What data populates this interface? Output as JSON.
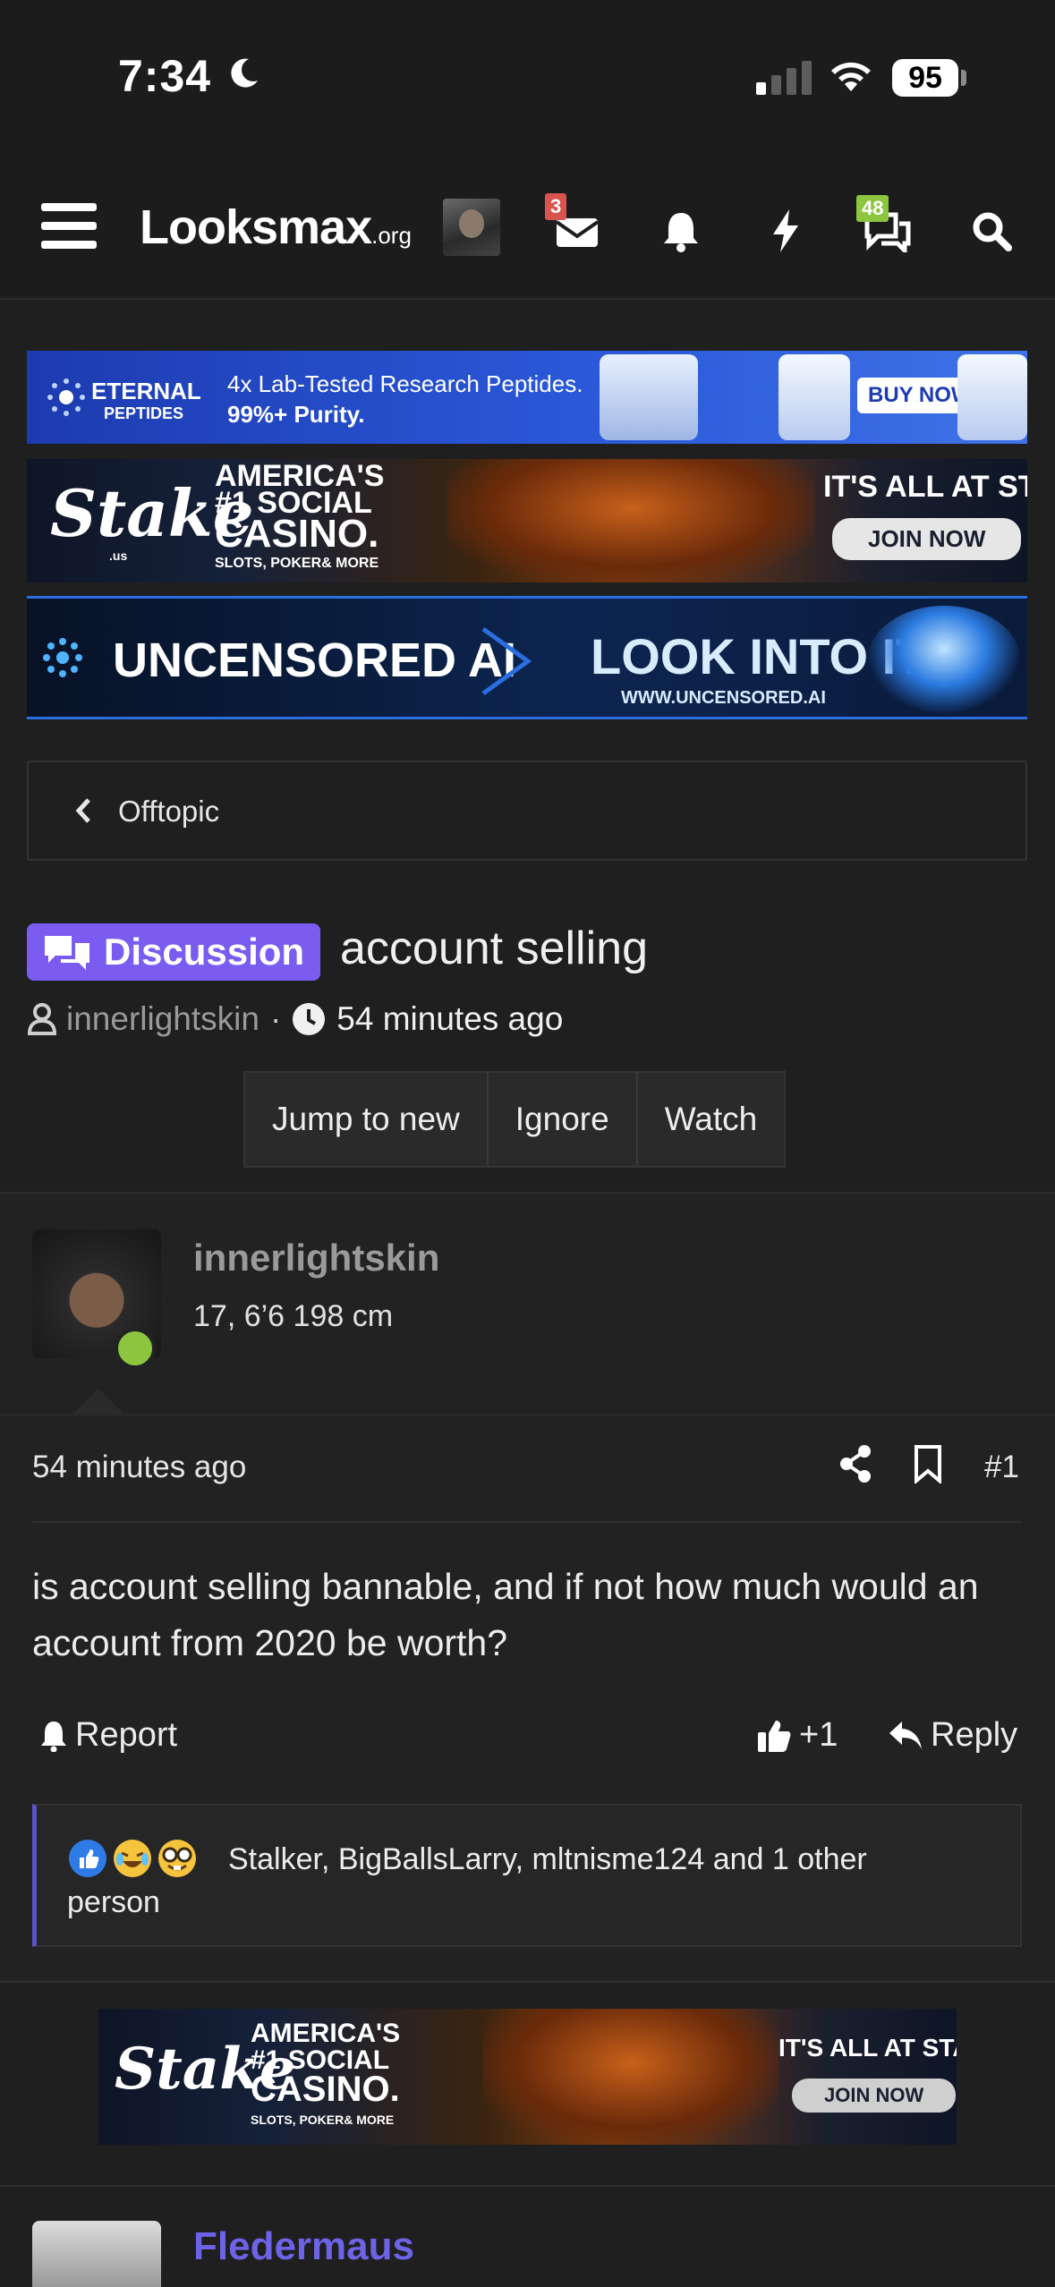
{
  "status_bar": {
    "time": "7:34",
    "battery": "95"
  },
  "nav": {
    "logo_main": "Looksmax",
    "logo_suffix": ".org",
    "inbox_badge": "3",
    "alerts_badge": "48"
  },
  "ads": {
    "eternal": {
      "brand": "ETERNAL",
      "brand_sub": "PEPTIDES",
      "line1": "4x Lab-Tested Research Peptides.",
      "line2": "99%+ Purity.",
      "cta": "BUY NOW"
    },
    "stake": {
      "brand": "Stake",
      "brand_sub": ".us",
      "head1": "AMERICA'S",
      "head2": "#1 SOCIAL",
      "head3": "CASINO.",
      "sub": "SLOTS, POKER& MORE",
      "tag": "IT'S ALL AT STAKE",
      "cta": "JOIN NOW"
    },
    "uncensored": {
      "brand": "UNCENSORED AI",
      "cta": "LOOK INTO IT",
      "url": "WWW.UNCENSORED.AI"
    }
  },
  "breadcrumb": {
    "label": "Offtopic"
  },
  "thread": {
    "prefix": "Discussion",
    "title": "account selling",
    "author": "innerlightskin",
    "separator": "·",
    "time": "54 minutes ago",
    "buttons": [
      "Jump to new",
      "Ignore",
      "Watch"
    ]
  },
  "post": {
    "username": "innerlightskin",
    "user_title": "17, 6’6 198 cm",
    "time": "54 minutes ago",
    "number": "#1",
    "body": "is account selling bannable, and if not how much would an account from 2020 be worth?",
    "report": "Report",
    "like_count": "+1",
    "reply": "Reply",
    "reactions_text": "Stalker, BigBallsLarry, mltnisme124 and 1 other person"
  },
  "next_post": {
    "username": "Fledermaus"
  },
  "colors": {
    "accent": "#7b5cf0",
    "online": "#8cc63f",
    "next_user": "#6c63e6"
  }
}
